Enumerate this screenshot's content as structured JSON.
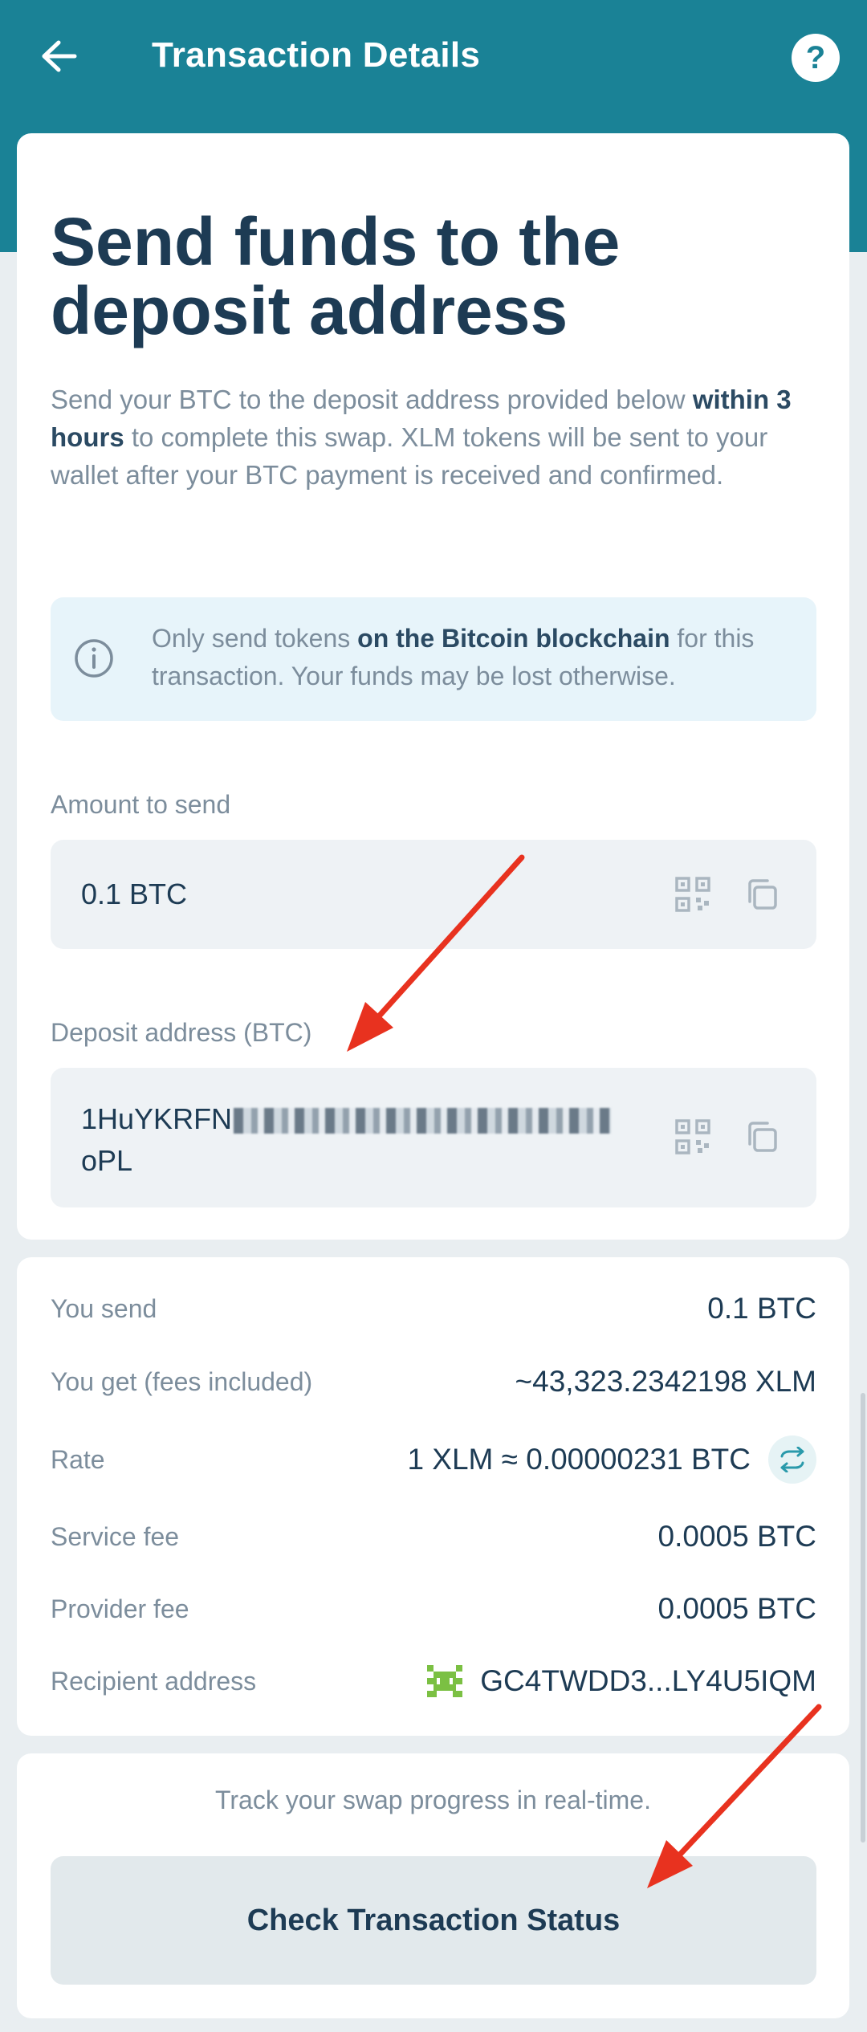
{
  "header": {
    "title": "Transaction Details",
    "help_label": "?"
  },
  "main": {
    "heading": "Send funds to the deposit address",
    "intro_part1": "Send your BTC to the deposit address provided below ",
    "intro_bold": "within 3 hours",
    "intro_part2": " to complete this swap. XLM tokens will be sent to your wallet after your BTC payment is received and confirmed.",
    "notice_part1": "Only send tokens ",
    "notice_bold": "on the Bitcoin blockchain",
    "notice_part2": " for this transaction. Your funds may be lost otherwise.",
    "amount_label": "Amount to send",
    "amount_value": "0.1 BTC",
    "deposit_label": "Deposit address (BTC)",
    "deposit_prefix": "1HuYKRFN",
    "deposit_suffix": "oPL"
  },
  "summary": {
    "rows": [
      {
        "label": "You send",
        "value": "0.1 BTC"
      },
      {
        "label": "You get (fees included)",
        "value": "~43,323.2342198 XLM"
      },
      {
        "label": "Rate",
        "value": "1 XLM ≈ 0.00000231 BTC"
      },
      {
        "label": "Service fee",
        "value": "0.0005 BTC"
      },
      {
        "label": "Provider fee",
        "value": "0.0005 BTC"
      },
      {
        "label": "Recipient address",
        "value": "GC4TWDD3...LY4U5IQM"
      }
    ]
  },
  "footer": {
    "track_text": "Track your swap progress in real-time.",
    "check_button": "Check Transaction Status"
  },
  "colors": {
    "header": "#1a8296",
    "annotation_arrow": "#e8321f",
    "text_dark": "#1d3b54",
    "text_muted": "#7c8d9c"
  },
  "icons": [
    "back-arrow-icon",
    "help-icon",
    "info-icon",
    "qr-code-icon",
    "copy-icon",
    "swap-icon",
    "identicon-avatar"
  ]
}
